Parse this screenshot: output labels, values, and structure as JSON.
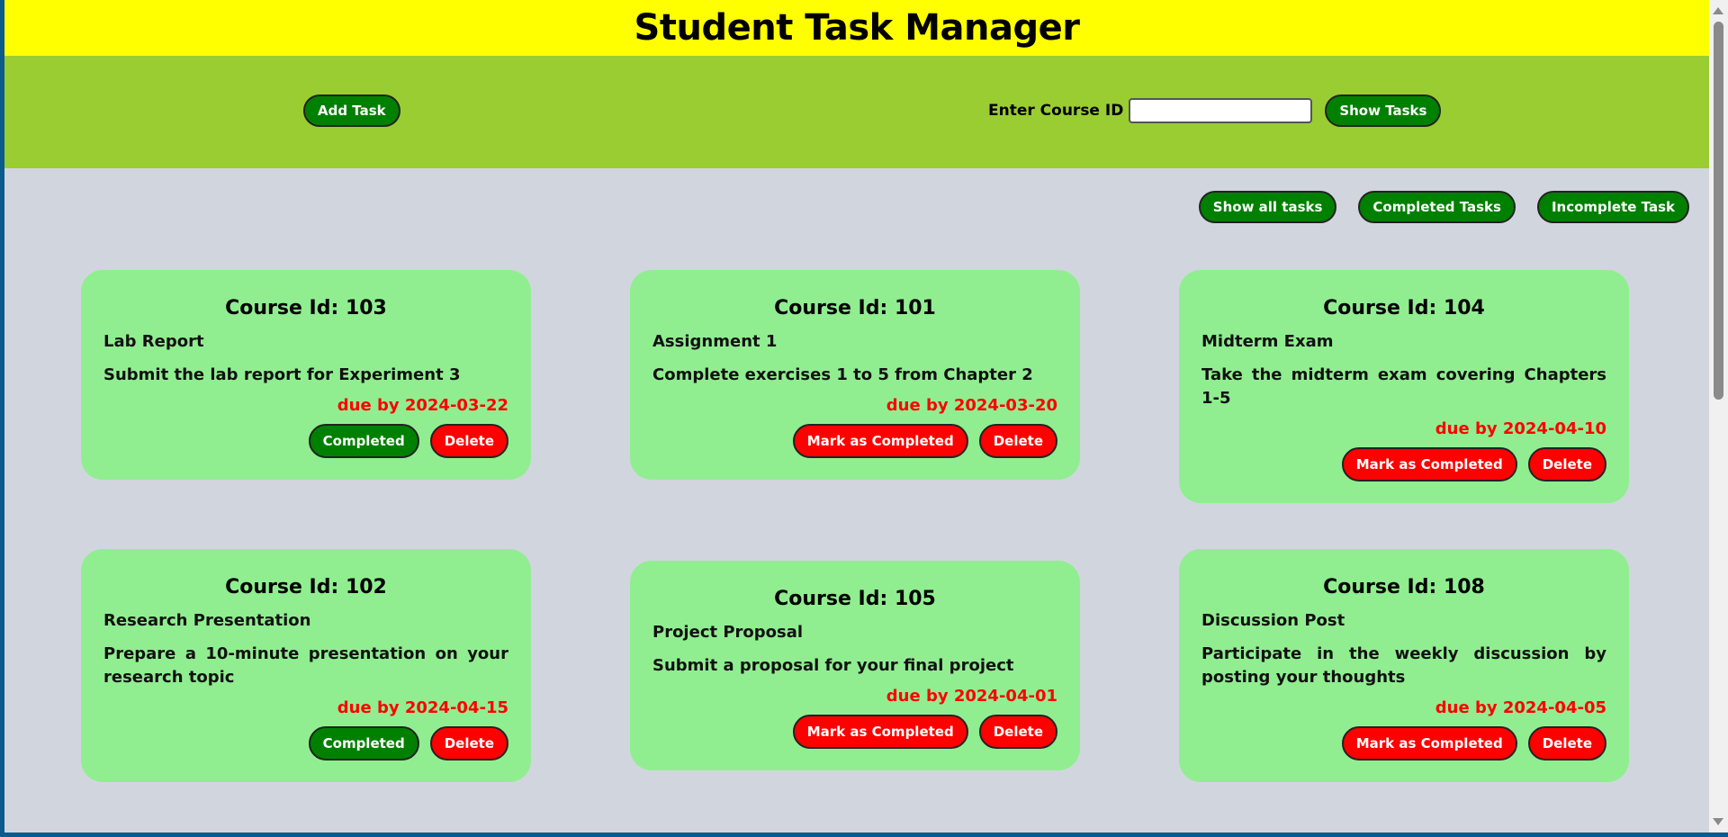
{
  "header": {
    "title": "Student Task Manager"
  },
  "toolbar": {
    "add_task_label": "Add Task",
    "course_label": "Enter Course ID",
    "course_value": "",
    "show_tasks_label": "Show Tasks"
  },
  "filters": {
    "all_label": "Show all tasks",
    "completed_label": "Completed Tasks",
    "incomplete_label": "Incomplete Task"
  },
  "tasks": [
    {
      "heading": "Course Id: 103",
      "title": "Lab Report",
      "description": "Submit the lab report for Experiment 3",
      "due": "due by 2024-03-22",
      "status_label": "Completed",
      "completed": true,
      "delete_label": "Delete"
    },
    {
      "heading": "Course Id: 101",
      "title": "Assignment 1",
      "description": "Complete exercises 1 to 5 from Chapter 2",
      "due": "due by 2024-03-20",
      "status_label": "Mark as Completed",
      "completed": false,
      "delete_label": "Delete"
    },
    {
      "heading": "Course Id: 104",
      "title": "Midterm Exam",
      "description": "Take the midterm exam covering Chapters 1-5",
      "due": "due by 2024-04-10",
      "status_label": "Mark as Completed",
      "completed": false,
      "delete_label": "Delete"
    },
    {
      "heading": "Course Id: 102",
      "title": "Research Presentation",
      "description": "Prepare a 10-minute presentation on your research topic",
      "due": "due by 2024-04-15",
      "status_label": "Completed",
      "completed": true,
      "delete_label": "Delete"
    },
    {
      "heading": "Course Id: 105",
      "title": "Project Proposal",
      "description": "Submit a proposal for your final project",
      "due": "due by 2024-04-01",
      "status_label": "Mark as Completed",
      "completed": false,
      "delete_label": "Delete"
    },
    {
      "heading": "Course Id: 108",
      "title": "Discussion Post",
      "description": "Participate in the weekly discussion by posting your thoughts",
      "due": "due by 2024-04-05",
      "status_label": "Mark as Completed",
      "completed": false,
      "delete_label": "Delete"
    }
  ],
  "colors": {
    "header_bg": "#ffff00",
    "toolbar_bg": "#9acd32",
    "page_bg": "#d1d6de",
    "card_bg": "#90ee90",
    "button_green": "#008000",
    "button_red": "#ff0000",
    "due_text": "#ff0000"
  }
}
